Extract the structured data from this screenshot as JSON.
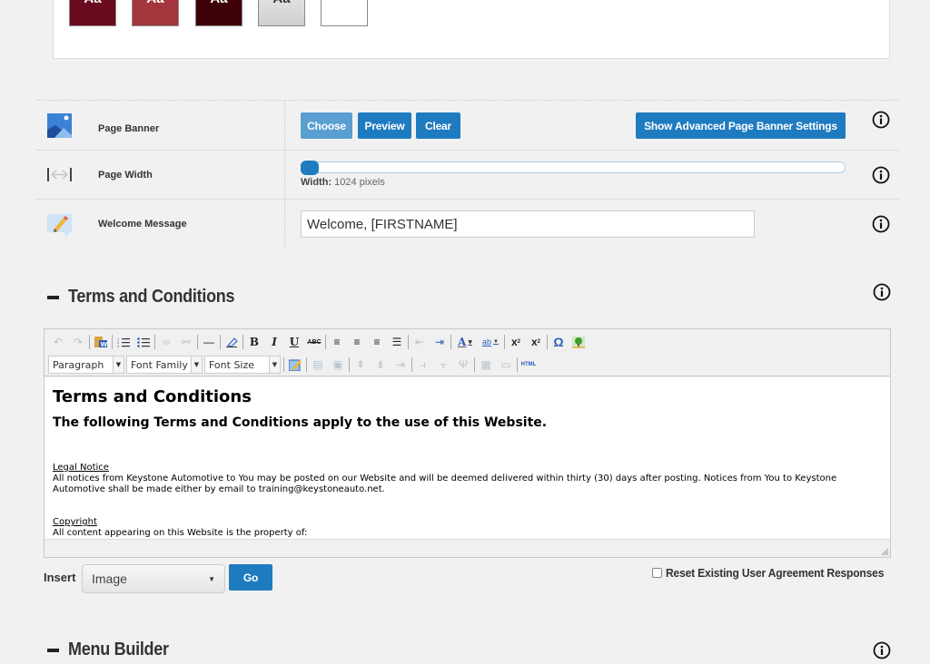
{
  "theme_swatches": [
    {
      "label": "Aa",
      "bg": "#6a0a1e",
      "fg": "#ffffff"
    },
    {
      "label": "Aa",
      "bg": "#a3363d",
      "fg": "#ffffff"
    },
    {
      "label": "Aa",
      "bg": "#3d0006",
      "fg": "#ffffff"
    },
    {
      "label": "Aa",
      "bg": "#d7d7d7",
      "fg": "#333333"
    },
    {
      "label": "",
      "bg": "#ffffff",
      "fg": "#999999"
    }
  ],
  "settings": {
    "page_banner": {
      "label": "Page Banner",
      "choose": "Choose",
      "preview": "Preview",
      "clear": "Clear",
      "advanced": "Show Advanced Page Banner Settings"
    },
    "page_width": {
      "label": "Page Width",
      "caption_key": "Width:",
      "caption_value": "1024 pixels",
      "slider_fraction": 0.0
    },
    "welcome_message": {
      "label": "Welcome Message",
      "value": "Welcome, [FIRSTNAME]"
    }
  },
  "terms": {
    "title": "Terms and Conditions",
    "toolbar": {
      "format_select": "Paragraph",
      "font_family_select": "Font Family",
      "font_size_select": "Font Size",
      "html_label": "HTML"
    },
    "content": {
      "heading": "Terms and Conditions",
      "subheading": "The following Terms and Conditions apply to the use of this Website.",
      "sections": [
        {
          "title": "Legal Notice",
          "body": "All notices from Keystone Automotive to You may be posted on our Website and will be deemed delivered within thirty (30) days after posting. Notices from You to Keystone Automotive shall be made either by email to training@keystoneauto.net."
        },
        {
          "title": "Copyright",
          "body": "All content appearing on this Website is the property of:"
        }
      ]
    },
    "insert_label": "Insert",
    "insert_value": "Image",
    "go_label": "Go",
    "reset_label": "Reset Existing User Agreement Responses",
    "reset_checked": false
  },
  "menu_builder": {
    "title": "Menu Builder"
  },
  "colors": {
    "primary": "#1f7bbf",
    "primary_light": "#5a9fd1"
  }
}
